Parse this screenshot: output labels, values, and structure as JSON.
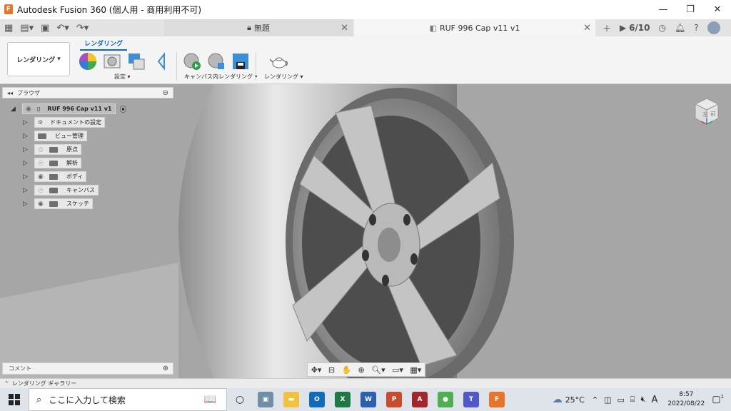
{
  "window": {
    "title": "Autodesk Fusion 360 (個人用 - 商用利用不可)",
    "controls": [
      "—",
      "❐",
      "✕"
    ]
  },
  "tabs": {
    "inactive_label": "無題",
    "active_label": "RUF 996 Cap v11 v1",
    "job_count": "6/10"
  },
  "ribbon": {
    "workspace_label": "レンダリング",
    "active_tab": "レンダリング",
    "groups": {
      "setup": "設定",
      "canvas_render": "キャンバス内レンダリング",
      "render": "レンダリング"
    }
  },
  "browser": {
    "title": "ブラウザ",
    "root": "RUF 996 Cap v11 v1",
    "items": [
      {
        "label": "ドキュメントの設定"
      },
      {
        "label": "ビュー管理"
      },
      {
        "label": "原点"
      },
      {
        "label": "解析"
      },
      {
        "label": "ボディ"
      },
      {
        "label": "キャンバス"
      },
      {
        "label": "スケッチ"
      }
    ]
  },
  "comments": {
    "label": "コメント"
  },
  "gallery": {
    "label": "レンダリング ギャラリー"
  },
  "viewcube": {
    "top": "左",
    "front": "前"
  },
  "taskbar": {
    "search_placeholder": "ここに入力して検索",
    "weather": "25°C",
    "ime": "A",
    "time": "8:57",
    "date": "2022/08/22",
    "notification_count": "1"
  },
  "colors": {
    "accent": "#0b67c2",
    "fusion_orange": "#e8742a",
    "viewport_gray": "#a8a8a8"
  }
}
